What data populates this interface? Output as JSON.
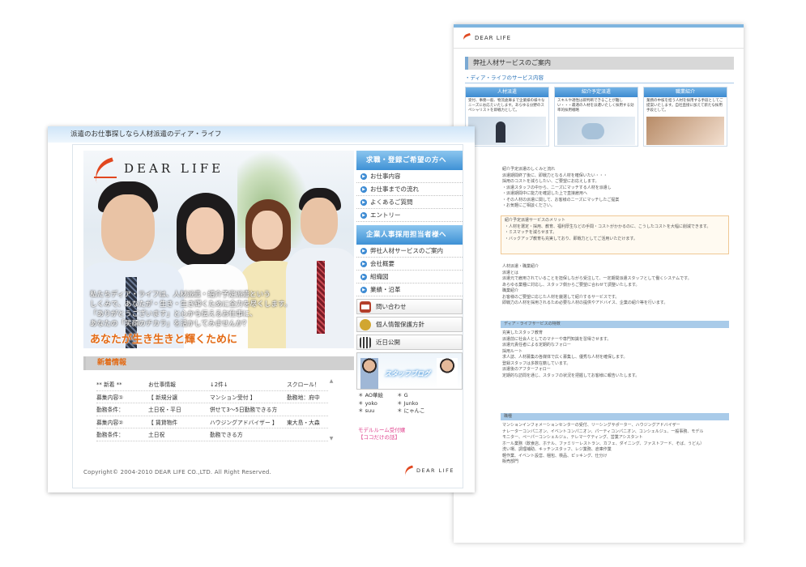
{
  "back_page": {
    "logo_text": "DEAR LIFE",
    "title": "弊社人材サービスのご案内",
    "subhead": "・ディア・ライフのサービス内容",
    "cards": [
      {
        "title": "人材派遣",
        "text": "受付、事務一般、物流倉庫まで企業様の様々なニーズにお応えいたします。あらゆる分野のスペシャリストを即戦力として。"
      },
      {
        "title": "紹介予定派遣",
        "text": "スキルや適性は即判断できることが難しい・・・最適の人材を派遣いたしく採用する効率的採用戦略"
      },
      {
        "title": "職業紹介",
        "text": "業務の中核を担う人材を採用する手段としてご提案いたします。自社直接に加えて新たな採用手段として。"
      }
    ],
    "text_lines_1": [
      "紹介予定派遣のしくみと流れ",
      "派遣期間終了後に、即戦力となる人材を確保いたい・・・",
      "採用のコストを減らしたい、ご要望にお応えします。",
      "・派遣スタッフの中から、ニーズにマッチする人材を派遣し",
      "・派遣期間中に能力を確認した上で直接雇用へ",
      "・その人材の派遣に関して、お客様のニーズにマッチしたご提案",
      "・お気軽にご相談ください。"
    ],
    "merit_title": "紹介予定派遣サービスのメリット",
    "merit_lines": [
      "・人材を選定・採用、教育、福利厚生などの手間・コストがかかるのに、こうしたコストを大幅に削減できます。",
      "・ミスマッチを減らせます。",
      "・バックアップ教育も充実しており、即戦力としてご活用いただけます。"
    ],
    "text_lines_2": [
      "人材派遣・職業紹介",
      "派遣とは",
      "派遣元で雇用されていることを担保しながら受注して、一定期間派遣スタッフとして働くシステムです。",
      "あらゆる業種に対応し、スタッフ側からご要望に合わせて調整いたします。",
      "職業紹介",
      "お客様のご要望に応じた人材を厳選して紹介するサービスです。",
      "即戦力の人材を採用されるため必要な人材の提供やアドバイス、企業の紹介等を行います。"
    ],
    "feature_title": "ディア・ライフサービスの特徴",
    "text_lines_3": [
      "充実したスタッフ教育",
      "派遣前に社会人としてのマナーや専門知識を習得させます。",
      "派遣元責任者による定期的なフォロー",
      "採用ルート",
      "求人誌、人材募集の各媒体で広く募集し、優秀な人材を確保します。",
      "登録スタッフは多数在籍しています。",
      "派遣後のアフターフォロー",
      "定期的な訪問を通じ、スタッフの状況を把握してお客様に報告いたします。"
    ],
    "table_title": "職種",
    "table_lines": [
      "マンションインフォメーションセンターの受付、リーシングサポーター、ハウジングアドバイザー",
      "ナレーターコンパニオン、イベントコンパニオン、パーティコンパニオン、コンシェルジュ、一般事務、モデル",
      "モニター、ペーパーコンシェルジュ、テレマーケティング、営業アシスタント",
      "ホール業務（飲食店、ホテル、ファミリーレストラン、カフェ、ダイニング、ファストフード、そば、うどん）",
      "洗い場、調理補助、キッチンスタッフ、レジ業務、倉庫作業",
      "軽作業、イベント設営、梱包、検品、ピッキング、仕分け",
      "販売部門"
    ]
  },
  "front_page": {
    "tagline": "派遣のお仕事探しなら人材派遣のディア・ライフ",
    "logo_text": "DEAR LIFE",
    "hero_copy": [
      "私たちディア・ライフは、人材派遣・紹介予定派遣という",
      "しくみで、あなたが・生き・生き輝くために全力を尽くします。",
      "「ありがとうございます」と心から伝えるお仕事に、",
      "あなたの「笑顔のチカラ」を活かしてみませんか？"
    ],
    "slogan": "あなたが生き生きと輝くために",
    "news_title": "新着情報",
    "news_rows": [
      [
        "** 新着 **",
        "お仕事情報",
        "↓2件↓",
        "スクロール！"
      ],
      [
        "募集内容①",
        "【 新規分譲",
        "マンション受付 】",
        "勤務地：府中"
      ],
      [
        "勤務条件：",
        "土日祝・平日",
        "併せて3～5日勤務できる方",
        ""
      ],
      [
        "募集内容②",
        "【 賃貸物件",
        "ハウジングアドバイザー 】",
        "東大島・大森"
      ],
      [
        "勤務条件：",
        "土日祝",
        "勤務できる方",
        ""
      ]
    ],
    "scroll_up": "▲",
    "scroll_down": "▼",
    "copyright": "Copyright© 2004-2010 DEAR LIFE CO.,LTD. All Right Reserved.",
    "footer_logo": "DEAR LIFE"
  },
  "nav": {
    "section1_title": "求職・登録ご希望の方へ",
    "section1_items": [
      "お仕事内容",
      "お仕事までの流れ",
      "よくあるご質問",
      "エントリー"
    ],
    "section2_title": "企業人事採用担当者様へ",
    "section2_items": [
      "弊社人材サービスのご案内",
      "会社概要",
      "組織図",
      "業績・沿革"
    ],
    "buttons": [
      "問い合わせ",
      "個人情報保護方針",
      "近日公開"
    ],
    "blog_label": "スタッフブログ",
    "staff": [
      [
        "AO華絵",
        "G"
      ],
      [
        "yoko",
        "Junko"
      ],
      [
        "suu",
        "にゃんこ"
      ]
    ],
    "staff_bullet": "＊",
    "model_lines": [
      "モデルルーム受付嬢",
      "【ココだけの話】"
    ]
  },
  "colors": {
    "accent_blue": "#3e91d5",
    "accent_orange": "#e36a14",
    "logo_red": "#e1471f",
    "pink_link": "#e0458f"
  }
}
